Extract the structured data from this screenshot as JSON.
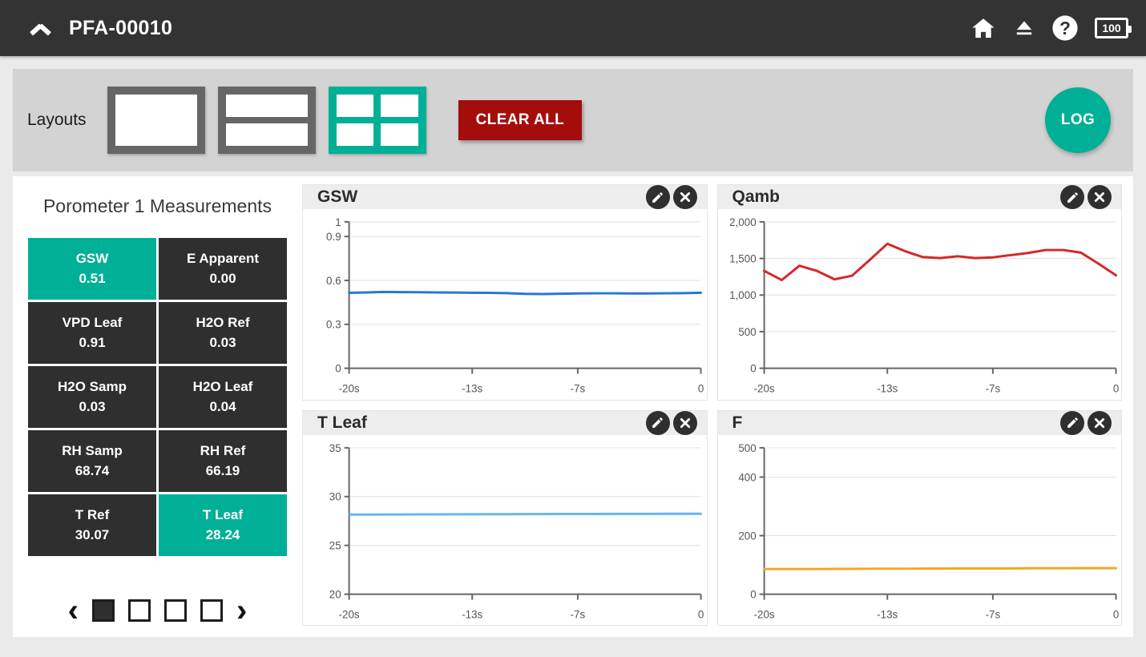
{
  "topbar": {
    "collapse_icon": "chevron-up-icon",
    "title": "PFA-00010",
    "icons": [
      "home-icon",
      "eject-icon",
      "help-icon"
    ],
    "battery_level": "100"
  },
  "toolbar": {
    "label": "Layouts",
    "layouts": [
      {
        "name": "layout-single",
        "panes": 1,
        "selected": false
      },
      {
        "name": "layout-two-rows",
        "panes": 2,
        "selected": false
      },
      {
        "name": "layout-quad",
        "panes": 4,
        "selected": true
      }
    ],
    "clear_all_label": "CLEAR ALL",
    "log_label": "LOG",
    "accent_color": "#00b096",
    "danger_color": "#a50d0d"
  },
  "measurements": {
    "title": "Porometer 1 Measurements",
    "tiles": [
      {
        "name": "GSW",
        "value": "0.51",
        "active": true
      },
      {
        "name": "E Apparent",
        "value": "0.00",
        "active": false
      },
      {
        "name": "VPD Leaf",
        "value": "0.91",
        "active": false
      },
      {
        "name": "H2O Ref",
        "value": "0.03",
        "active": false
      },
      {
        "name": "H2O Samp",
        "value": "0.03",
        "active": false
      },
      {
        "name": "H2O Leaf",
        "value": "0.04",
        "active": false
      },
      {
        "name": "RH Samp",
        "value": "68.74",
        "active": false
      },
      {
        "name": "RH Ref",
        "value": "66.19",
        "active": false
      },
      {
        "name": "T Ref",
        "value": "30.07",
        "active": false
      },
      {
        "name": "T Leaf",
        "value": "28.24",
        "active": true
      }
    ],
    "pager": {
      "prev_icon": "chevron-left-icon",
      "next_icon": "chevron-right-icon",
      "pages": 4,
      "current_page": 1
    }
  },
  "charts": [
    {
      "title": "GSW",
      "edit_icon": "pencil-icon",
      "close_icon": "close-icon",
      "chart_data": {
        "type": "line",
        "title": "GSW",
        "xlabel": "",
        "ylabel": "",
        "color": "#2878d4",
        "grid": true,
        "legend": "none",
        "xlim": [
          -20,
          0
        ],
        "ylim": [
          0,
          1
        ],
        "xticks": [
          -20,
          -13,
          -7,
          0
        ],
        "xticklabels": [
          "-20s",
          "-13s",
          "-7s",
          "0"
        ],
        "yticks": [
          0,
          0.3,
          0.6,
          0.9,
          1
        ],
        "yticklabels": [
          "0",
          "0.3",
          "0.6",
          "0.9",
          "1"
        ],
        "x": [
          -20,
          -19,
          -18,
          -17,
          -16,
          -15,
          -14,
          -13,
          -12,
          -11,
          -10,
          -9,
          -8,
          -7,
          -6,
          -5,
          -4,
          -3,
          -2,
          -1,
          0
        ],
        "values": [
          0.515,
          0.518,
          0.521,
          0.52,
          0.519,
          0.518,
          0.517,
          0.516,
          0.515,
          0.513,
          0.508,
          0.507,
          0.509,
          0.511,
          0.512,
          0.512,
          0.511,
          0.511,
          0.512,
          0.513,
          0.516
        ]
      }
    },
    {
      "title": "Qamb",
      "edit_icon": "pencil-icon",
      "close_icon": "close-icon",
      "chart_data": {
        "type": "line",
        "title": "Qamb",
        "xlabel": "",
        "ylabel": "",
        "color": "#d62728",
        "grid": true,
        "legend": "none",
        "xlim": [
          -20,
          0
        ],
        "ylim": [
          0,
          2000
        ],
        "xticks": [
          -20,
          -13,
          -7,
          0
        ],
        "xticklabels": [
          "-20s",
          "-13s",
          "-7s",
          "0"
        ],
        "yticks": [
          0,
          500,
          1000,
          1500,
          2000
        ],
        "yticklabels": [
          "0",
          "500",
          "1,000",
          "1,500",
          "2,000"
        ],
        "x": [
          -20,
          -19,
          -18,
          -17,
          -16,
          -15,
          -14,
          -13,
          -12,
          -11,
          -10,
          -9,
          -8,
          -7,
          -6,
          -5,
          -4,
          -3,
          -2,
          -1,
          0
        ],
        "values": [
          1330,
          1205,
          1400,
          1330,
          1215,
          1265,
          1480,
          1700,
          1600,
          1520,
          1505,
          1530,
          1505,
          1515,
          1545,
          1575,
          1615,
          1615,
          1580,
          1430,
          1270
        ]
      }
    },
    {
      "title": "T Leaf",
      "edit_icon": "pencil-icon",
      "close_icon": "close-icon",
      "chart_data": {
        "type": "line",
        "title": "T Leaf",
        "xlabel": "",
        "ylabel": "",
        "color": "#64b5f6",
        "grid": true,
        "legend": "none",
        "xlim": [
          -20,
          0
        ],
        "ylim": [
          20,
          35
        ],
        "xticks": [
          -20,
          -13,
          -7,
          0
        ],
        "xticklabels": [
          "-20s",
          "-13s",
          "-7s",
          "0"
        ],
        "yticks": [
          20,
          25,
          30,
          35
        ],
        "yticklabels": [
          "20",
          "25",
          "30",
          "35"
        ],
        "x": [
          -20,
          -19,
          -18,
          -17,
          -16,
          -15,
          -14,
          -13,
          -12,
          -11,
          -10,
          -9,
          -8,
          -7,
          -6,
          -5,
          -4,
          -3,
          -2,
          -1,
          0
        ],
        "values": [
          28.16,
          28.16,
          28.17,
          28.17,
          28.18,
          28.18,
          28.19,
          28.19,
          28.2,
          28.2,
          28.21,
          28.21,
          28.22,
          28.22,
          28.22,
          28.23,
          28.23,
          28.23,
          28.24,
          28.24,
          28.24
        ]
      }
    },
    {
      "title": "F",
      "edit_icon": "pencil-icon",
      "close_icon": "close-icon",
      "chart_data": {
        "type": "line",
        "title": "F",
        "xlabel": "",
        "ylabel": "",
        "color": "#f5a623",
        "grid": true,
        "legend": "none",
        "xlim": [
          -20,
          0
        ],
        "ylim": [
          0,
          500
        ],
        "xticks": [
          -20,
          -13,
          -7,
          0
        ],
        "xticklabels": [
          "-20s",
          "-13s",
          "-7s",
          "0"
        ],
        "yticks": [
          0,
          200,
          400,
          500
        ],
        "yticklabels": [
          "0",
          "200",
          "400",
          "500"
        ],
        "x": [
          -20,
          -19,
          -18,
          -17,
          -16,
          -15,
          -14,
          -13,
          -12,
          -11,
          -10,
          -9,
          -8,
          -7,
          -6,
          -5,
          -4,
          -3,
          -2,
          -1,
          0
        ],
        "values": [
          86,
          86,
          86,
          86,
          86.5,
          86.5,
          87,
          87,
          87,
          87.5,
          87.5,
          88,
          88,
          88,
          88,
          88.5,
          88.5,
          88.5,
          89,
          89,
          89
        ]
      }
    }
  ]
}
